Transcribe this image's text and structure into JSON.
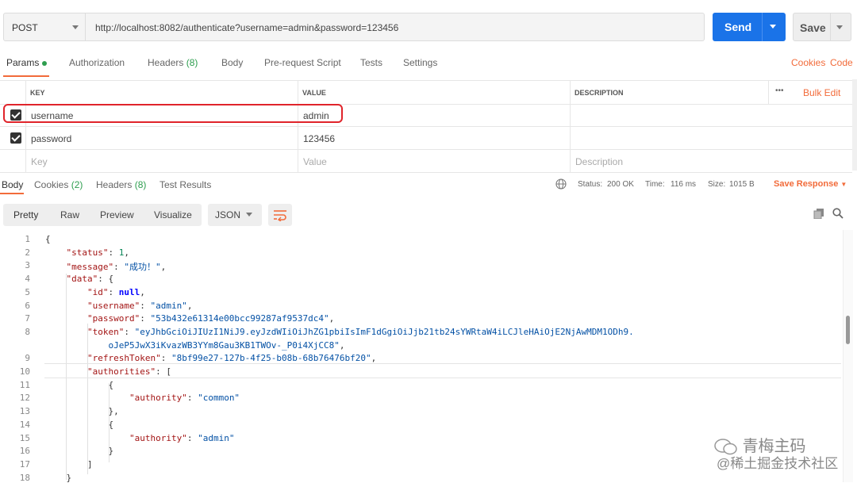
{
  "request": {
    "method": "POST",
    "url": "http://localhost:8082/authenticate?username=admin&password=123456",
    "send_label": "Send",
    "save_label": "Save"
  },
  "req_tabs": {
    "params": "Params",
    "authorization": "Authorization",
    "headers": "Headers",
    "headers_count": "(8)",
    "body": "Body",
    "prerequest": "Pre-request Script",
    "tests": "Tests",
    "settings": "Settings",
    "cookies": "Cookies",
    "code": "Code"
  },
  "params_table": {
    "col_key": "KEY",
    "col_value": "VALUE",
    "col_description": "DESCRIPTION",
    "more": "•••",
    "bulk_edit": "Bulk Edit",
    "rows": [
      {
        "key": "username",
        "value": "admin"
      },
      {
        "key": "password",
        "value": "123456"
      }
    ],
    "placeholder_key": "Key",
    "placeholder_value": "Value",
    "placeholder_description": "Description"
  },
  "resp_tabs": {
    "body": "Body",
    "cookies": "Cookies",
    "cookies_count": "(2)",
    "headers": "Headers",
    "headers_count": "(8)",
    "test_results": "Test Results"
  },
  "resp_meta": {
    "status_label": "Status:",
    "status_value": "200 OK",
    "time_label": "Time:",
    "time_value": "116 ms",
    "size_label": "Size:",
    "size_value": "1015 B",
    "save_response": "Save Response"
  },
  "view_modes": {
    "pretty": "Pretty",
    "raw": "Raw",
    "preview": "Preview",
    "visualize": "Visualize",
    "format": "JSON"
  },
  "code_lines": [
    {
      "n": "1",
      "text": "{"
    },
    {
      "n": "2",
      "text": "    \"status\": 1,"
    },
    {
      "n": "3",
      "text": "    \"message\": \"成功！\","
    },
    {
      "n": "4",
      "text": "    \"data\": {"
    },
    {
      "n": "5",
      "text": "        \"id\": null,"
    },
    {
      "n": "6",
      "text": "        \"username\": \"admin\","
    },
    {
      "n": "7",
      "text": "        \"password\": \"53b432e61314e00bcc99287af9537dc4\","
    },
    {
      "n": "8",
      "text": "        \"token\": \"eyJhbGciOiJIUzI1NiJ9.eyJzdWIiOiJhZG1pbiIsImF1dGgiOiJjb21tb24sYWRtaW4iLCJleHAiOjE2NjAwMDM1ODh9."
    },
    {
      "n": "",
      "text": "            oJeP5JwX3iKvazWB3YYm8Gau3KB1TWOv-_P0i4XjCC8\","
    },
    {
      "n": "9",
      "text": "        \"refreshToken\": \"8bf99e27-127b-4f25-b08b-68b76476bf20\","
    },
    {
      "n": "10",
      "text": "        \"authorities\": ["
    },
    {
      "n": "11",
      "text": "            {"
    },
    {
      "n": "12",
      "text": "                \"authority\": \"common\""
    },
    {
      "n": "13",
      "text": "            },"
    },
    {
      "n": "14",
      "text": "            {"
    },
    {
      "n": "15",
      "text": "                \"authority\": \"admin\""
    },
    {
      "n": "16",
      "text": "            }"
    },
    {
      "n": "17",
      "text": "        ]"
    },
    {
      "n": "18",
      "text": "    }"
    }
  ],
  "watermark": {
    "line1": "青梅主码",
    "line2": "@稀土掘金技术社区"
  }
}
